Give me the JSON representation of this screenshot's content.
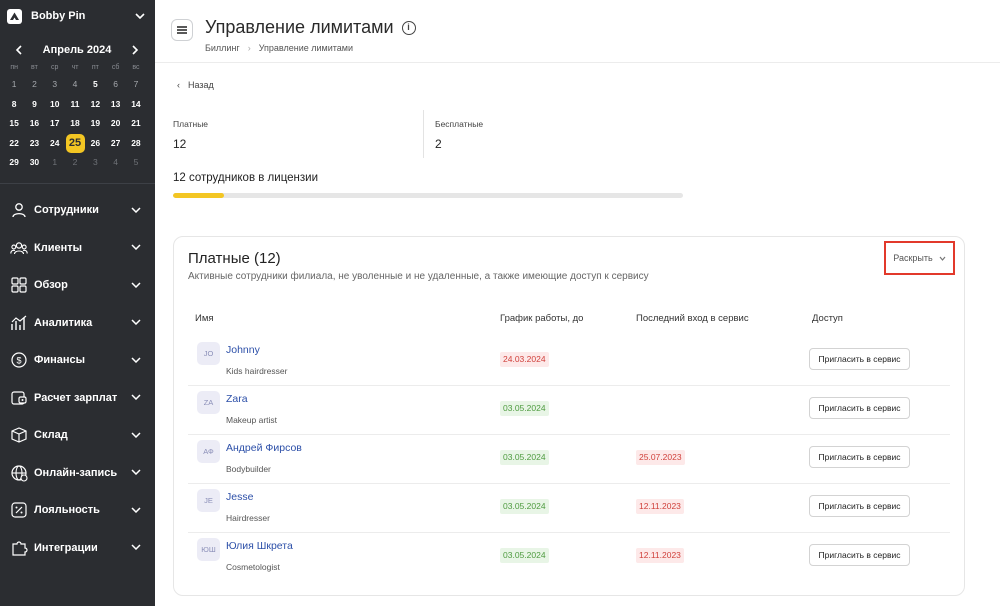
{
  "sidebar": {
    "org_name": "Bobby Pin",
    "calendar": {
      "title": "Апрель 2024",
      "weekdays": [
        "пн",
        "вт",
        "ср",
        "чт",
        "пт",
        "сб",
        "вс"
      ],
      "today": "25",
      "days": [
        {
          "d": "1",
          "s": "dim"
        },
        {
          "d": "2",
          "s": "dim"
        },
        {
          "d": "3",
          "s": "dim"
        },
        {
          "d": "4",
          "s": "dim"
        },
        {
          "d": "5",
          "s": "normal"
        },
        {
          "d": "6",
          "s": "dim"
        },
        {
          "d": "7",
          "s": "dim"
        },
        {
          "d": "8",
          "s": "normal"
        },
        {
          "d": "9",
          "s": "normal"
        },
        {
          "d": "10",
          "s": "normal"
        },
        {
          "d": "11",
          "s": "normal"
        },
        {
          "d": "12",
          "s": "normal"
        },
        {
          "d": "13",
          "s": "normal"
        },
        {
          "d": "14",
          "s": "normal"
        },
        {
          "d": "15",
          "s": "normal"
        },
        {
          "d": "16",
          "s": "normal"
        },
        {
          "d": "17",
          "s": "normal"
        },
        {
          "d": "18",
          "s": "normal"
        },
        {
          "d": "19",
          "s": "normal"
        },
        {
          "d": "20",
          "s": "normal"
        },
        {
          "d": "21",
          "s": "normal"
        },
        {
          "d": "22",
          "s": "normal"
        },
        {
          "d": "23",
          "s": "normal"
        },
        {
          "d": "24",
          "s": "normal"
        },
        {
          "d": "25",
          "s": "today"
        },
        {
          "d": "26",
          "s": "normal"
        },
        {
          "d": "27",
          "s": "normal"
        },
        {
          "d": "28",
          "s": "normal"
        },
        {
          "d": "29",
          "s": "normal"
        },
        {
          "d": "30",
          "s": "normal"
        },
        {
          "d": "1",
          "s": "muted"
        },
        {
          "d": "2",
          "s": "muted"
        },
        {
          "d": "3",
          "s": "muted"
        },
        {
          "d": "4",
          "s": "muted"
        },
        {
          "d": "5",
          "s": "muted"
        }
      ]
    },
    "nav": [
      {
        "label": "Сотрудники",
        "icon": "user-icon"
      },
      {
        "label": "Клиенты",
        "icon": "users-icon"
      },
      {
        "label": "Обзор",
        "icon": "grid-icon"
      },
      {
        "label": "Аналитика",
        "icon": "analytics-icon"
      },
      {
        "label": "Финансы",
        "icon": "dollar-icon"
      },
      {
        "label": "Расчет зарплат",
        "icon": "wallet-icon"
      },
      {
        "label": "Склад",
        "icon": "box-icon"
      },
      {
        "label": "Онлайн-запись",
        "icon": "globe-icon"
      },
      {
        "label": "Лояльность",
        "icon": "percent-icon"
      },
      {
        "label": "Интеграции",
        "icon": "puzzle-icon"
      }
    ]
  },
  "header": {
    "title": "Управление лимитами",
    "breadcrumb": [
      "Биллинг",
      "Управление лимитами"
    ]
  },
  "back_label": "Назад",
  "stats": [
    {
      "label": "Платные",
      "value": "12"
    },
    {
      "label": "Бесплатные",
      "value": "2"
    }
  ],
  "license_text": "12 сотрудников в лицензии",
  "license_progress": 0.1,
  "card": {
    "title": "Платные (12)",
    "subtitle": "Активные сотрудники филиала, не уволенные и не удаленные, а также имеющие доступ к сервису",
    "expand_label": "Раскрыть",
    "columns": [
      "Имя",
      "График работы, до",
      "Последний вход в сервис",
      "Доступ"
    ],
    "rows": [
      {
        "initials": "JO",
        "name": "Johnny",
        "role": "Kids hairdresser",
        "schedule": "24.03.2024",
        "schedule_status": "red",
        "last_login": "",
        "access": "Пригласить в сервис"
      },
      {
        "initials": "ZA",
        "name": "Zara",
        "role": "Makeup artist",
        "schedule": "03.05.2024",
        "schedule_status": "green",
        "last_login": "",
        "access": "Пригласить в сервис"
      },
      {
        "initials": "АФ",
        "name": "Андрей Фирсов",
        "role": "Bodybuilder",
        "schedule": "03.05.2024",
        "schedule_status": "green",
        "last_login": "25.07.2023",
        "access": "Пригласить в сервис"
      },
      {
        "initials": "JE",
        "name": "Jesse",
        "role": "Hairdresser",
        "schedule": "03.05.2024",
        "schedule_status": "green",
        "last_login": "12.11.2023",
        "access": "Пригласить в сервис"
      },
      {
        "initials": "ЮШ",
        "name": "Юлия Шкрета",
        "role": "Cosmetologist",
        "schedule": "03.05.2024",
        "schedule_status": "green",
        "last_login": "12.11.2023",
        "access": "Пригласить в сервис"
      }
    ]
  }
}
